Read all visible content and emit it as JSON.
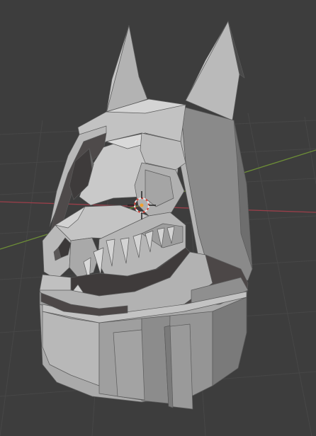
{
  "viewport": {
    "background_color": "#3d3d3d",
    "grid_color": "#474747",
    "x_axis_color": "#9b3f4a",
    "y_axis_color": "#6e8f37",
    "cursor_colors": [
      "#e8e8e8",
      "#d9463c"
    ],
    "mesh_base_color": "#a8a8a8",
    "mesh_shadow_color": "#4e4a4a"
  },
  "model": {
    "icon": "skull-hood-mesh",
    "cursor_icon": "3d-cursor-icon"
  }
}
